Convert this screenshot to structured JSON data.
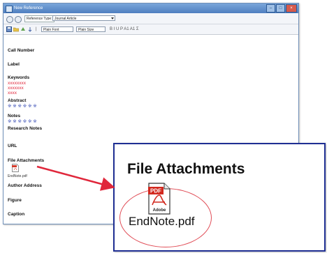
{
  "window": {
    "title": "New Reference",
    "reference_type_label": "Reference Type:",
    "reference_type_value": "Journal Article",
    "font_value": "Plain Font",
    "size_value": "Plain Size",
    "format_marks": "B  I  U  P  A1  A1  Σ"
  },
  "fields": {
    "call_number": "Call Number",
    "label": "Label",
    "keywords": "Keywords",
    "keyword_values": [
      "xxxxxxxx",
      "xxxxxxx",
      "xxxx"
    ],
    "abstract": "Abstract",
    "abstract_value": "※ ※ ※ ※ ※ ※",
    "notes": "Notes",
    "notes_value": "※ ※ ※ ※ ※ ※",
    "research_notes": "Research Notes",
    "url": "URL",
    "file_attachments": "File Attachments",
    "attachment_name": "EndNote.pdf",
    "author_address": "Author Address",
    "figure": "Figure",
    "caption": "Caption"
  },
  "zoom": {
    "title": "File Attachments",
    "pdf_badge": "PDF",
    "adobe_label": "Adobe",
    "file_name": "EndNote.pdf"
  },
  "colors": {
    "accent_red": "#e0273b",
    "zoom_border": "#1f2f93"
  }
}
